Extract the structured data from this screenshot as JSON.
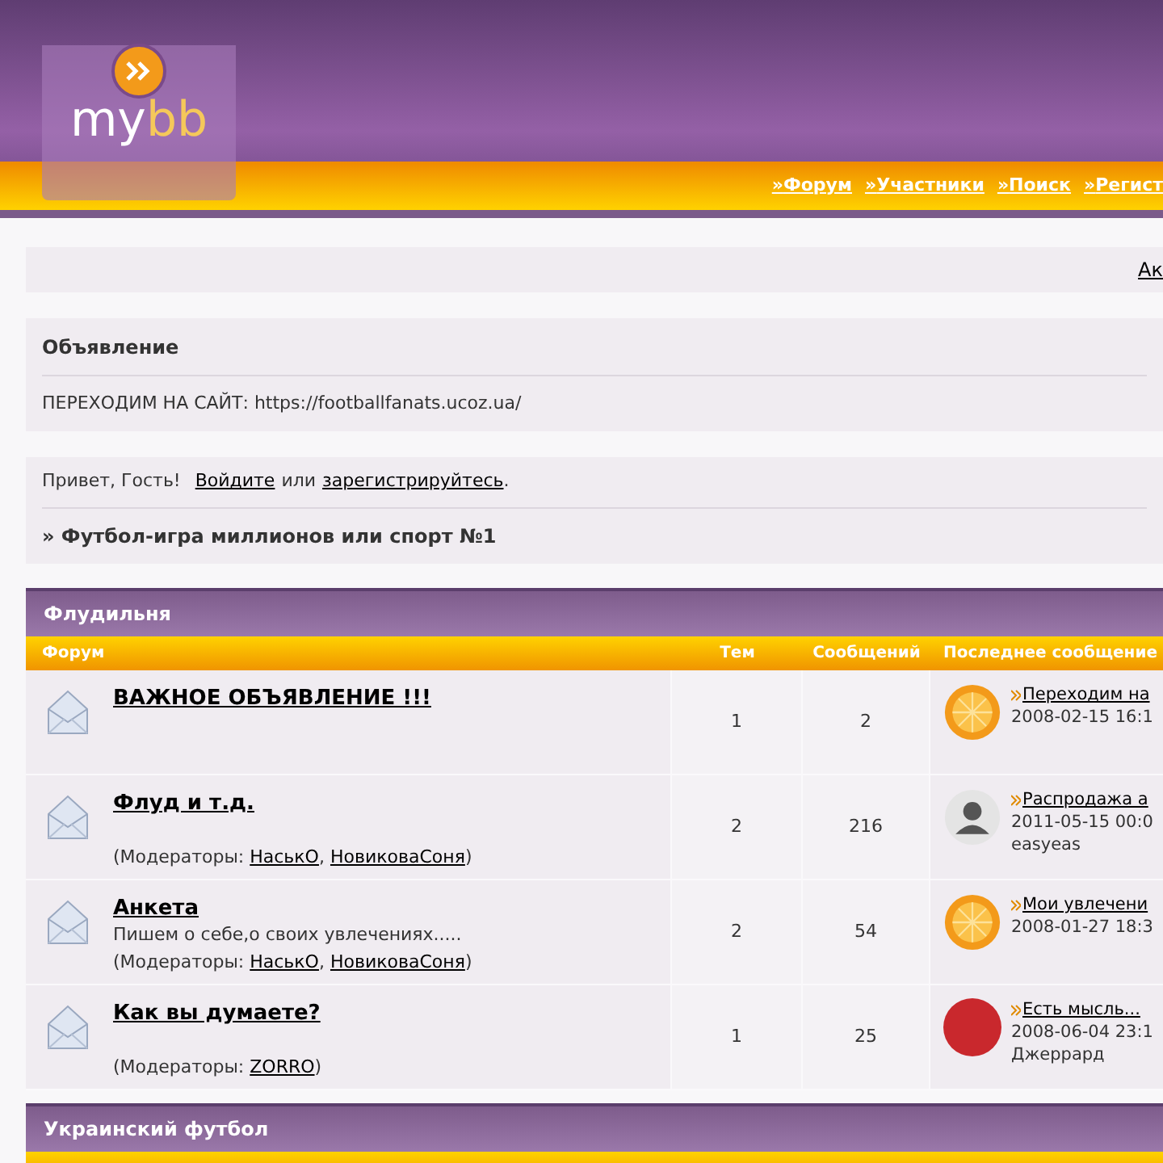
{
  "header": {
    "logo": {
      "my": "my",
      "bb": "bb"
    },
    "nav": [
      {
        "marker": "»",
        "label": "Форум"
      },
      {
        "marker": "»",
        "label": "Участники"
      },
      {
        "marker": "»",
        "label": "Поиск"
      },
      {
        "marker": "»",
        "label": "Регист"
      }
    ]
  },
  "topbar": {
    "link": "Ак"
  },
  "announcement": {
    "title": "Объявление",
    "text": "ПЕРЕХОДИМ НА САЙТ: https://footballfanats.ucoz.ua/"
  },
  "welcome": {
    "greeting": "Привет, Гость!",
    "login": "Войдите",
    "or": "или",
    "register": "зарегистрируйтесь",
    "end": ".",
    "board_title": "» Футбол-игра миллионов или спорт №1"
  },
  "categories": [
    {
      "title": "Флудильня",
      "columns": [
        "Форум",
        "Тем",
        "Сообщений",
        "Последнее сообщение"
      ],
      "forums": [
        {
          "name": "ВАЖНОЕ ОБЪЯВЛЕНИЕ !!!",
          "topics": "1",
          "posts": "2",
          "last": {
            "kind": "fruit",
            "link": "Переходим на",
            "date": "2008-02-15 16:1"
          }
        },
        {
          "name": "Флуд и т.д.",
          "moderators_label": "(Модераторы:",
          "moderators": [
            {
              "name": "НаськО",
              "after": ","
            },
            {
              "name": "НовиковаСоня",
              "after": ")"
            }
          ],
          "topics": "2",
          "posts": "216",
          "last": {
            "kind": "silhouette",
            "link": "Распродажа а",
            "date": "2011-05-15 00:0",
            "author": "easyeas"
          }
        },
        {
          "name": "Анкета",
          "description": "Пишем о себе,о своих увлечениях.....",
          "moderators_label": "(Модераторы:",
          "moderators": [
            {
              "name": "НаськО",
              "after": ","
            },
            {
              "name": "НовиковаСоня",
              "after": ")"
            }
          ],
          "topics": "2",
          "posts": "54",
          "last": {
            "kind": "fruit",
            "link": "Мои увлечени",
            "date": "2008-01-27 18:3"
          }
        },
        {
          "name": "Как вы думаете?",
          "moderators_label": "(Модераторы:",
          "moderators": [
            {
              "name": "ZORRO",
              "after": ")"
            }
          ],
          "topics": "1",
          "posts": "25",
          "last": {
            "kind": "photo",
            "link": "Есть мысль...",
            "date": "2008-06-04 23:1",
            "author": "Джеррард"
          }
        }
      ]
    },
    {
      "title": "Украинский футбол"
    }
  ]
}
